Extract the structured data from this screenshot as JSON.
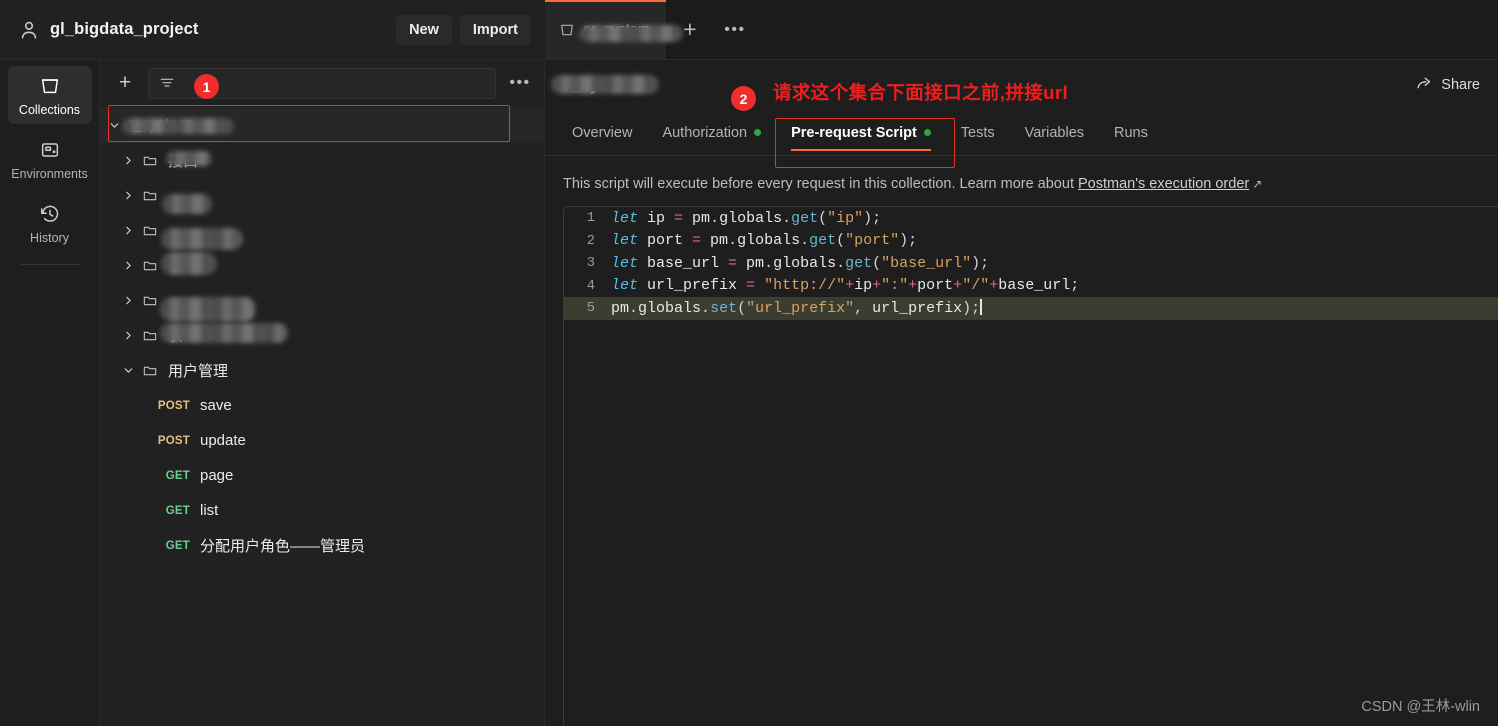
{
  "workspace": {
    "title": "gl_bigdata_project",
    "user_icon": "user-icon",
    "new_label": "New",
    "import_label": "Import"
  },
  "tabstrip": {
    "tab_label": "er_system",
    "tab_icon": "collection-icon",
    "plus_label": "+",
    "dots_label": "•••"
  },
  "rail": {
    "items": [
      {
        "icon": "collections-icon",
        "label": "Collections"
      },
      {
        "icon": "environments-icon",
        "label": "Environments"
      },
      {
        "icon": "history-icon",
        "label": "History"
      }
    ],
    "extra_icon": "apps-grid-plus-icon"
  },
  "sidebar": {
    "add_label": "+",
    "search": {
      "placeholder": "",
      "value": "",
      "filter_icon": "filter-icon"
    },
    "dots_label": "•••",
    "collection": {
      "label": "r_system",
      "expanded": true
    },
    "folders": [
      {
        "label": "接口",
        "expanded": false,
        "blur_width": 46
      },
      {
        "label": "",
        "expanded": false,
        "blur_width": 48
      },
      {
        "label": "",
        "expanded": false,
        "blur_width": 78
      },
      {
        "label": "表",
        "expanded": false,
        "blur_width": 52
      },
      {
        "label": "",
        "expanded": false,
        "blur_width": 92
      },
      {
        "label": "表",
        "expanded": false,
        "blur_width": 122
      },
      {
        "label": "用户管理",
        "expanded": true,
        "blur_width": 0
      }
    ],
    "requests": [
      {
        "method": "POST",
        "name": "save"
      },
      {
        "method": "POST",
        "name": "update"
      },
      {
        "method": "GET",
        "name": "page"
      },
      {
        "method": "GET",
        "name": "list"
      },
      {
        "method": "GET",
        "name": "分配用户角色——管理员"
      }
    ]
  },
  "main": {
    "breadcrumb_title": "er_system",
    "share_label": "Share",
    "share_icon": "share-arrow-icon",
    "tabs": [
      {
        "label": "Overview",
        "dot": false,
        "active": false
      },
      {
        "label": "Authorization",
        "dot": true,
        "active": false
      },
      {
        "label": "Pre-request Script",
        "dot": true,
        "active": true
      },
      {
        "label": "Tests",
        "dot": false,
        "active": false
      },
      {
        "label": "Variables",
        "dot": false,
        "active": false
      },
      {
        "label": "Runs",
        "dot": false,
        "active": false
      }
    ],
    "description_prefix": "This script will execute before every request in this collection. Learn more about ",
    "description_link": "Postman's execution order",
    "link_arrow": "↗"
  },
  "code": {
    "lines": [
      {
        "n": "1",
        "active": false
      },
      {
        "n": "2",
        "active": false
      },
      {
        "n": "3",
        "active": false
      },
      {
        "n": "4",
        "active": false
      },
      {
        "n": "5",
        "active": true
      }
    ],
    "line1_text": "let ip = pm.globals.get(\"ip\");",
    "line2_text": "let port = pm.globals.get(\"port\");",
    "line3_text": "let base_url = pm.globals.get(\"base_url\");",
    "line4_text": "let url_prefix = \"http://\"+ip+\":\"+port+\"/\"+base_url;",
    "line5_text": "pm.globals.set(\"url_prefix\", url_prefix);"
  },
  "annotations": {
    "badge1": "1",
    "badge2": "2",
    "note": "请求这个集合下面接口之前,拼接url",
    "accent_red": "#ef2d2d",
    "accent_orange": "#ff6c37"
  },
  "watermark": "CSDN @王林-wlin"
}
